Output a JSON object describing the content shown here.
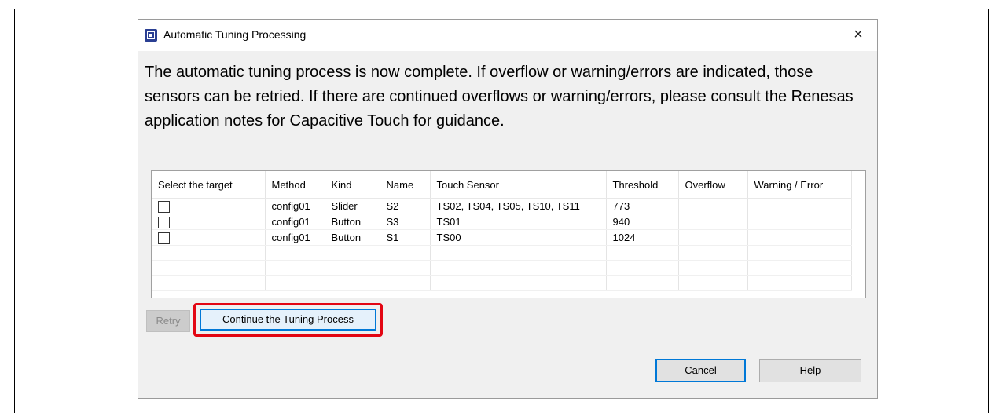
{
  "dialog": {
    "title": "Automatic Tuning Processing",
    "close_label": "×",
    "message": "The automatic tuning process is now complete. If overflow or warning/errors are indicated, those sensors can be retried. If there are continued overflows or warning/errors, please consult the Renesas application notes for Capacitive Touch for guidance."
  },
  "table": {
    "headers": {
      "select": "Select the target",
      "method": "Method",
      "kind": "Kind",
      "name": "Name",
      "sensor": "Touch Sensor",
      "threshold": "Threshold",
      "overflow": "Overflow",
      "warning": "Warning / Error"
    },
    "rows": [
      {
        "checked": false,
        "method": "config01",
        "kind": "Slider",
        "name": "S2",
        "sensor": "TS02, TS04, TS05, TS10, TS11",
        "threshold": "773",
        "overflow": "",
        "warning": ""
      },
      {
        "checked": false,
        "method": "config01",
        "kind": "Button",
        "name": "S3",
        "sensor": "TS01",
        "threshold": "940",
        "overflow": "",
        "warning": ""
      },
      {
        "checked": false,
        "method": "config01",
        "kind": "Button",
        "name": "S1",
        "sensor": "TS00",
        "threshold": "1024",
        "overflow": "",
        "warning": ""
      }
    ]
  },
  "buttons": {
    "retry": "Retry",
    "continue": "Continue the Tuning Process",
    "cancel": "Cancel",
    "help": "Help"
  },
  "colors": {
    "highlight": "#e30613",
    "focus_border": "#0078d7"
  },
  "icons": {
    "app": "renesas-chip-icon",
    "close": "close-icon"
  }
}
